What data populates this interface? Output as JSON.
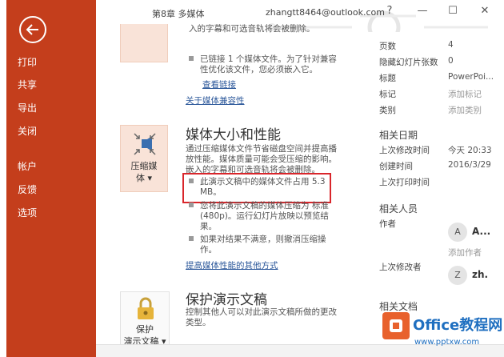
{
  "titlebar": {
    "doc_title": "第8章 多媒体",
    "user": "zhangtt8464@outlook.com",
    "help": "?",
    "minimize": "—",
    "maximize": "☐",
    "close": "✕"
  },
  "nav": {
    "items": [
      "打印",
      "共享",
      "导出",
      "关闭",
      "帐户",
      "反馈",
      "选项"
    ]
  },
  "compat": {
    "partial_line": "入的字幕和可选音轨将会被删除。",
    "bullet": "已链接 1 个媒体文件。为了针对兼容性优化该文件，您必须嵌入它。",
    "bullet_l1": "已链接 1 个媒体文件。为了针对兼容",
    "bullet_l2": "性优化该文件，您必须嵌入它。",
    "view_links": "查看链接",
    "about_link": "关于媒体兼容性"
  },
  "media": {
    "tile_label1": "压缩媒",
    "tile_label2": "体 ▾",
    "title": "媒体大小和性能",
    "desc_l1": "通过压缩媒体文件节省磁盘空间并提高播",
    "desc_l2": "放性能。媒体质量可能会受压缩的影响。",
    "desc_l3": "嵌入的字幕和可选音轨将会被删除。",
    "b1_l1": "此演示文稿中的媒体文件占用 5.3",
    "b1_l2": "MB。",
    "b2_l1": "您将此演示文稿的媒体压缩为 标准",
    "b2_l2": "(480p)。运行幻灯片放映以预览结",
    "b2_l3": "果。",
    "b3_l1": "如果对结果不满意，则撤消压缩操",
    "b3_l2": "作。",
    "perf_link": "提高媒体性能的其他方式"
  },
  "protect": {
    "tile_label1": "保护",
    "tile_label2": "演示文稿 ▾",
    "title": "保护演示文稿",
    "desc_l1": "控制其他人可以对此演示文稿所做的更改",
    "desc_l2": "类型。"
  },
  "props": {
    "r0_label": "页数",
    "r0_value": "4",
    "r1_label": "隐藏幻灯片张数",
    "r1_value": "0",
    "r2_label": "标题",
    "r2_value": "PowerPoi...",
    "r3_label": "标记",
    "r3_value": "添加标记",
    "r4_label": "类别",
    "r4_value": "添加类别",
    "dates_head": "相关日期",
    "d0_label": "上次修改时间",
    "d0_value": "今天 20:33",
    "d1_label": "创建时间",
    "d1_value": "2016/3/29",
    "d2_label": "上次打印时间",
    "people_head": "相关人员",
    "author_label": "作者",
    "author_initial": "A",
    "author_name": "A...",
    "add_author": "添加作者",
    "modifier_label": "上次修改者",
    "modifier_initial": "Z",
    "modifier_name": "zh.",
    "docs_head": "相关文档"
  },
  "watermark": {
    "brand": "Office教程网",
    "url": "www.pptxw.com"
  }
}
